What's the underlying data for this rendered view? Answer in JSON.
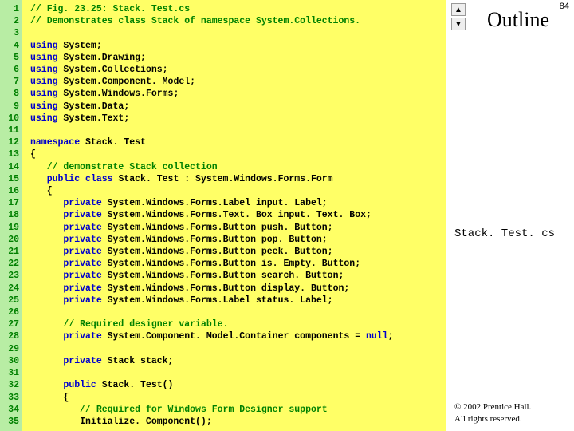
{
  "slide": {
    "outline_label": "Outline",
    "page_number": "84",
    "file_label": "Stack. Test. cs",
    "copyright_line1": "© 2002 Prentice Hall.",
    "copyright_line2": "All rights reserved.",
    "nav_up_glyph": "▲",
    "nav_down_glyph": "▼"
  },
  "code": {
    "line_count": 35,
    "lines": [
      {
        "n": 1,
        "seg": [
          {
            "c": "c-comment",
            "t": "// Fig. 23.25: Stack. Test.cs"
          }
        ]
      },
      {
        "n": 2,
        "seg": [
          {
            "c": "c-comment",
            "t": "// Demonstrates class Stack of namespace System.Collections."
          }
        ]
      },
      {
        "n": 3,
        "seg": []
      },
      {
        "n": 4,
        "seg": [
          {
            "c": "c-kw",
            "t": "using "
          },
          {
            "c": "c-plain",
            "t": "System;"
          }
        ]
      },
      {
        "n": 5,
        "seg": [
          {
            "c": "c-kw",
            "t": "using "
          },
          {
            "c": "c-plain",
            "t": "System.Drawing;"
          }
        ]
      },
      {
        "n": 6,
        "seg": [
          {
            "c": "c-kw",
            "t": "using "
          },
          {
            "c": "c-plain",
            "t": "System.Collections;"
          }
        ]
      },
      {
        "n": 7,
        "seg": [
          {
            "c": "c-kw",
            "t": "using "
          },
          {
            "c": "c-plain",
            "t": "System.Component. Model;"
          }
        ]
      },
      {
        "n": 8,
        "seg": [
          {
            "c": "c-kw",
            "t": "using "
          },
          {
            "c": "c-plain",
            "t": "System.Windows.Forms;"
          }
        ]
      },
      {
        "n": 9,
        "seg": [
          {
            "c": "c-kw",
            "t": "using "
          },
          {
            "c": "c-plain",
            "t": "System.Data;"
          }
        ]
      },
      {
        "n": 10,
        "seg": [
          {
            "c": "c-kw",
            "t": "using "
          },
          {
            "c": "c-plain",
            "t": "System.Text;"
          }
        ]
      },
      {
        "n": 11,
        "seg": []
      },
      {
        "n": 12,
        "seg": [
          {
            "c": "c-kw",
            "t": "namespace "
          },
          {
            "c": "c-plain",
            "t": "Stack. Test"
          }
        ]
      },
      {
        "n": 13,
        "seg": [
          {
            "c": "c-plain",
            "t": "{"
          }
        ]
      },
      {
        "n": 14,
        "seg": [
          {
            "c": "c-plain",
            "t": "   "
          },
          {
            "c": "c-comment",
            "t": "// demonstrate Stack collection"
          }
        ]
      },
      {
        "n": 15,
        "seg": [
          {
            "c": "c-plain",
            "t": "   "
          },
          {
            "c": "c-kw",
            "t": "public class "
          },
          {
            "c": "c-plain",
            "t": "Stack. Test : System.Windows.Forms.Form"
          }
        ]
      },
      {
        "n": 16,
        "seg": [
          {
            "c": "c-plain",
            "t": "   {"
          }
        ]
      },
      {
        "n": 17,
        "seg": [
          {
            "c": "c-plain",
            "t": "      "
          },
          {
            "c": "c-kw",
            "t": "private "
          },
          {
            "c": "c-plain",
            "t": "System.Windows.Forms.Label input. Label;"
          }
        ]
      },
      {
        "n": 18,
        "seg": [
          {
            "c": "c-plain",
            "t": "      "
          },
          {
            "c": "c-kw",
            "t": "private "
          },
          {
            "c": "c-plain",
            "t": "System.Windows.Forms.Text. Box input. Text. Box;"
          }
        ]
      },
      {
        "n": 19,
        "seg": [
          {
            "c": "c-plain",
            "t": "      "
          },
          {
            "c": "c-kw",
            "t": "private "
          },
          {
            "c": "c-plain",
            "t": "System.Windows.Forms.Button push. Button;"
          }
        ]
      },
      {
        "n": 20,
        "seg": [
          {
            "c": "c-plain",
            "t": "      "
          },
          {
            "c": "c-kw",
            "t": "private "
          },
          {
            "c": "c-plain",
            "t": "System.Windows.Forms.Button pop. Button;"
          }
        ]
      },
      {
        "n": 21,
        "seg": [
          {
            "c": "c-plain",
            "t": "      "
          },
          {
            "c": "c-kw",
            "t": "private "
          },
          {
            "c": "c-plain",
            "t": "System.Windows.Forms.Button peek. Button;"
          }
        ]
      },
      {
        "n": 22,
        "seg": [
          {
            "c": "c-plain",
            "t": "      "
          },
          {
            "c": "c-kw",
            "t": "private "
          },
          {
            "c": "c-plain",
            "t": "System.Windows.Forms.Button is. Empty. Button;"
          }
        ]
      },
      {
        "n": 23,
        "seg": [
          {
            "c": "c-plain",
            "t": "      "
          },
          {
            "c": "c-kw",
            "t": "private "
          },
          {
            "c": "c-plain",
            "t": "System.Windows.Forms.Button search. Button;"
          }
        ]
      },
      {
        "n": 24,
        "seg": [
          {
            "c": "c-plain",
            "t": "      "
          },
          {
            "c": "c-kw",
            "t": "private "
          },
          {
            "c": "c-plain",
            "t": "System.Windows.Forms.Button display. Button;"
          }
        ]
      },
      {
        "n": 25,
        "seg": [
          {
            "c": "c-plain",
            "t": "      "
          },
          {
            "c": "c-kw",
            "t": "private "
          },
          {
            "c": "c-plain",
            "t": "System.Windows.Forms.Label status. Label;"
          }
        ]
      },
      {
        "n": 26,
        "seg": []
      },
      {
        "n": 27,
        "seg": [
          {
            "c": "c-plain",
            "t": "      "
          },
          {
            "c": "c-comment",
            "t": "// Required designer variable."
          }
        ]
      },
      {
        "n": 28,
        "seg": [
          {
            "c": "c-plain",
            "t": "      "
          },
          {
            "c": "c-kw",
            "t": "private "
          },
          {
            "c": "c-plain",
            "t": "System.Component. Model.Container components = "
          },
          {
            "c": "c-kw",
            "t": "null"
          },
          {
            "c": "c-plain",
            "t": ";"
          }
        ]
      },
      {
        "n": 29,
        "seg": []
      },
      {
        "n": 30,
        "seg": [
          {
            "c": "c-plain",
            "t": "      "
          },
          {
            "c": "c-kw",
            "t": "private "
          },
          {
            "c": "c-plain",
            "t": "Stack stack;"
          }
        ]
      },
      {
        "n": 31,
        "seg": []
      },
      {
        "n": 32,
        "seg": [
          {
            "c": "c-plain",
            "t": "      "
          },
          {
            "c": "c-kw",
            "t": "public "
          },
          {
            "c": "c-plain",
            "t": "Stack. Test()"
          }
        ]
      },
      {
        "n": 33,
        "seg": [
          {
            "c": "c-plain",
            "t": "      {"
          }
        ]
      },
      {
        "n": 34,
        "seg": [
          {
            "c": "c-plain",
            "t": "         "
          },
          {
            "c": "c-comment",
            "t": "// Required for Windows Form Designer support"
          }
        ]
      },
      {
        "n": 35,
        "seg": [
          {
            "c": "c-plain",
            "t": "         Initialize. Component();"
          }
        ]
      }
    ]
  }
}
